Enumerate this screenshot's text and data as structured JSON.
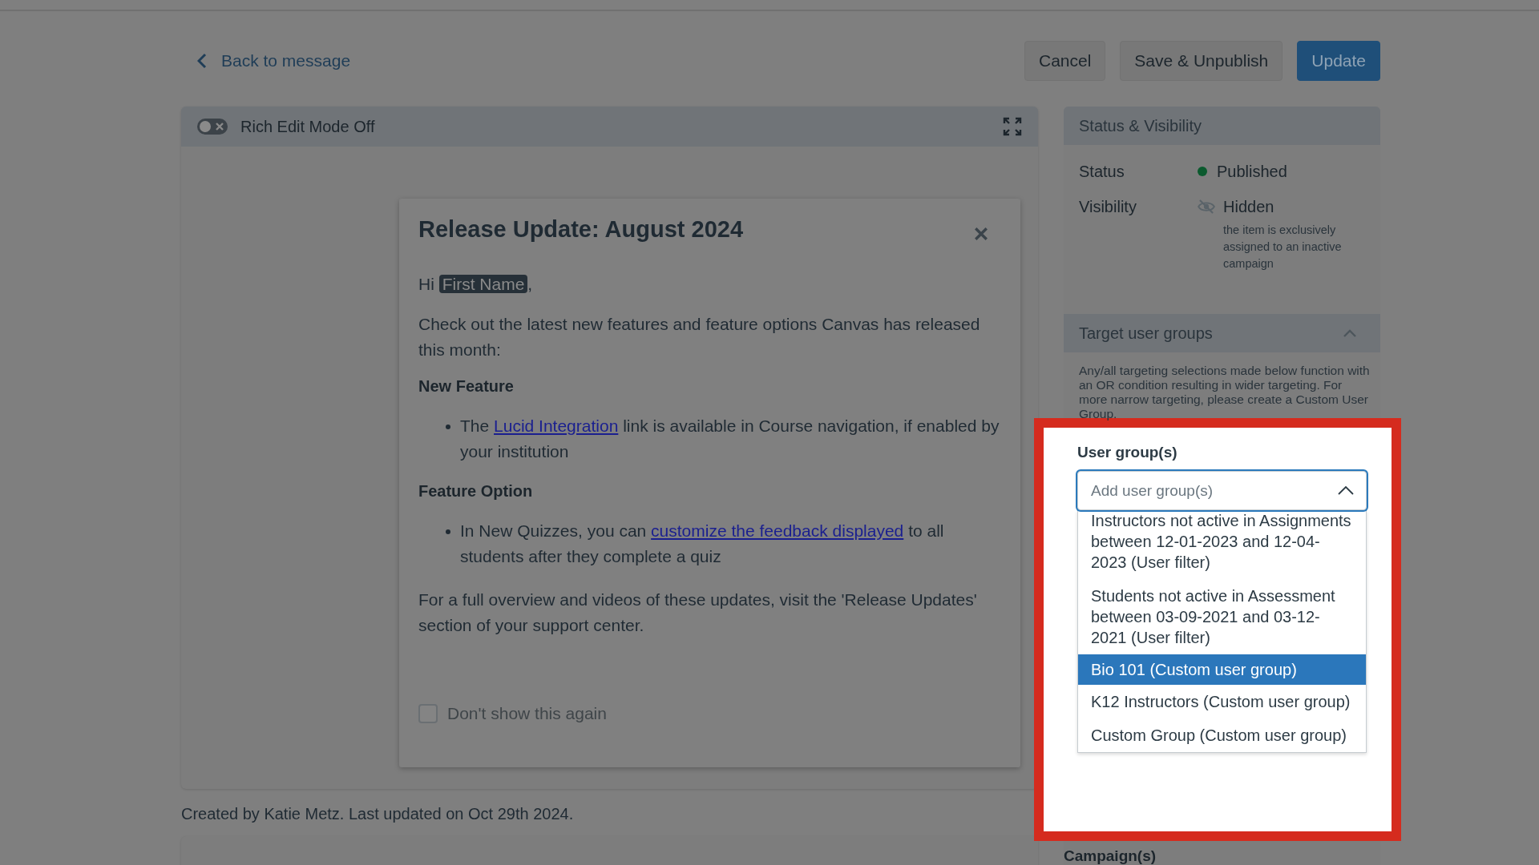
{
  "header": {
    "back_link": "Back to message",
    "buttons": [
      {
        "label": "Cancel",
        "kind": "secondary"
      },
      {
        "label": "Save & Unpublish",
        "kind": "secondary"
      },
      {
        "label": "Update",
        "kind": "primary"
      }
    ]
  },
  "editor": {
    "toolbar": {
      "label": "Rich Edit Mode Off",
      "on": false
    },
    "preview": {
      "title": "Release Update: August 2024",
      "blocks": [
        {
          "kind": "greeting",
          "before": "Hi ",
          "field": "First Name",
          "after": ","
        },
        {
          "kind": "paragraph",
          "text": "Check out the latest new features and feature options Canvas has released this month:"
        },
        {
          "kind": "heading",
          "text": "New Feature"
        },
        {
          "kind": "bullet",
          "before": "The ",
          "link": "Lucid Integration",
          "after": " link is available in Course navigation, if enabled by your institution"
        },
        {
          "kind": "heading",
          "text": "Feature Option"
        },
        {
          "kind": "bullet",
          "before": "In New Quizzes, you can ",
          "link": "customize the feedback displayed",
          "after": " to all students after they complete a quiz"
        },
        {
          "kind": "paragraph",
          "text": "For a full overview and videos of these updates, visit the 'Release Updates' section of your support center."
        }
      ],
      "checkbox": {
        "label": "Don't show this again",
        "checked": false,
        "disabled": true
      }
    }
  },
  "footer": "Created by Katie Metz. Last updated on Oct 29th 2024.",
  "sidebar": {
    "status_visibility": {
      "title": "Status & Visibility",
      "rows": [
        {
          "kind": "status",
          "label": "Status",
          "value": "Published"
        },
        {
          "kind": "visibility",
          "label": "Visibility",
          "value": "Hidden",
          "note": "the item is exclusively assigned to an inactive campaign"
        }
      ]
    },
    "target": {
      "title": "Target user groups",
      "expanded": true,
      "description": "Any/all targeting selections made below function with an OR condition resulting in wider targeting. For more narrow targeting, please create a Custom User Group.",
      "user_groups": {
        "label": "User group(s)",
        "placeholder": "Add user group(s)",
        "highlighted": true,
        "open": true,
        "options": [
          {
            "label": "Instructors not active in Assignments between 12-01-2023 and 12-04-2023 (User filter)",
            "selected": false
          },
          {
            "label": "Students not active in Assessment between 03-09-2021 and 03-12-2021 (User filter)",
            "selected": false
          },
          {
            "label": "Bio 101 (Custom user group)",
            "selected": true
          },
          {
            "label": "K12 Instructors (Custom user group)",
            "selected": false
          },
          {
            "label": "Custom Group (Custom user group)",
            "selected": false
          }
        ]
      },
      "campaigns_label": "Campaign(s)"
    }
  }
}
